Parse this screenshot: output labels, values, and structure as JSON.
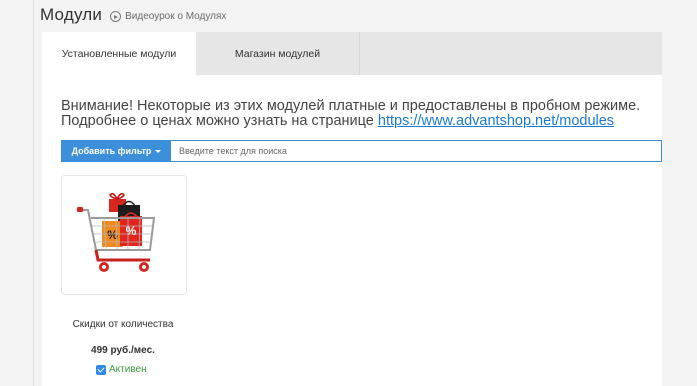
{
  "header": {
    "title": "Модули",
    "video_link": "Видеоурок о Модулях"
  },
  "tabs": [
    {
      "label": "Установленные модули",
      "active": true
    },
    {
      "label": "Магазин модулей",
      "active": false
    }
  ],
  "notice": {
    "line1": "Внимание! Некоторые из этих модулей платные и предоставлены в пробном режиме.",
    "line2_prefix": "Подробнее о ценах можно узнать на странице ",
    "link": "https://www.advantshop.net/modules"
  },
  "filter": {
    "button_label": "Добавить фильтр",
    "search_placeholder": "Введите текст для поиска"
  },
  "modules": [
    {
      "name": "Скидки от количества",
      "price": "499 руб./мес.",
      "status": "Активен",
      "active": true,
      "image_icon": "shopping-cart-icon"
    }
  ],
  "colors": {
    "accent": "#3c8fd9",
    "link": "#1a7bd6",
    "active_status": "#3c9a3c"
  }
}
